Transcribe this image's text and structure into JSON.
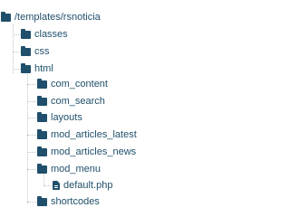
{
  "tree": {
    "root": {
      "label": "/templates/rsnoticia",
      "icon": "folder-icon"
    },
    "classes": {
      "label": "classes",
      "icon": "folder-icon"
    },
    "css": {
      "label": "css",
      "icon": "folder-icon"
    },
    "html": {
      "label": "html",
      "icon": "folder-icon"
    },
    "com_content": {
      "label": "com_content",
      "icon": "folder-icon"
    },
    "com_search": {
      "label": "com_search",
      "icon": "folder-icon"
    },
    "layouts": {
      "label": "layouts",
      "icon": "folder-icon"
    },
    "mod_articles_latest": {
      "label": "mod_articles_latest",
      "icon": "folder-icon"
    },
    "mod_articles_news": {
      "label": "mod_articles_news",
      "icon": "folder-icon"
    },
    "mod_menu": {
      "label": "mod_menu",
      "icon": "folder-icon"
    },
    "default_php": {
      "label": "default.php",
      "icon": "file-icon"
    },
    "shortcodes": {
      "label": "shortcodes",
      "icon": "folder-icon"
    }
  },
  "colors": {
    "icon": "#1f4f6b",
    "text": "#1f4f6b",
    "guide": "#bfc7cc"
  }
}
